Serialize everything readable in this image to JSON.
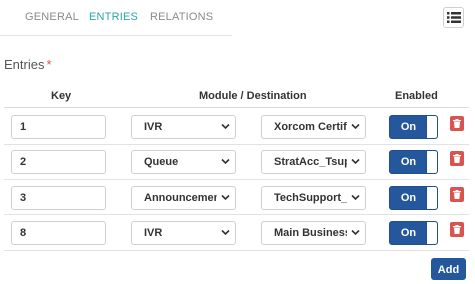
{
  "tabs": [
    {
      "label": "GENERAL",
      "active": false
    },
    {
      "label": "ENTRIES",
      "active": true
    },
    {
      "label": "RELATIONS",
      "active": false
    }
  ],
  "section": {
    "label": "Entries",
    "required_mark": "*"
  },
  "table": {
    "headers": {
      "key": "Key",
      "module": "Module / Destination",
      "enabled": "Enabled"
    },
    "rows": [
      {
        "key": "1",
        "module": "IVR",
        "destination": "Xorcom Certifie",
        "enabled": "On"
      },
      {
        "key": "2",
        "module": "Queue",
        "destination": "StratAcc_Tsup",
        "enabled": "On"
      },
      {
        "key": "3",
        "module": "Announcement",
        "destination": "TechSupport_Jo",
        "enabled": "On"
      },
      {
        "key": "8",
        "module": "IVR",
        "destination": "Main Business H",
        "enabled": "On"
      }
    ]
  },
  "add_label": "Add",
  "colors": {
    "accent": "#2aa6a6",
    "primary": "#24579b",
    "danger": "#d9534f"
  },
  "icons": {
    "view_toggle": "list-icon",
    "delete": "trash-icon",
    "select": "chevron-down-icon"
  }
}
